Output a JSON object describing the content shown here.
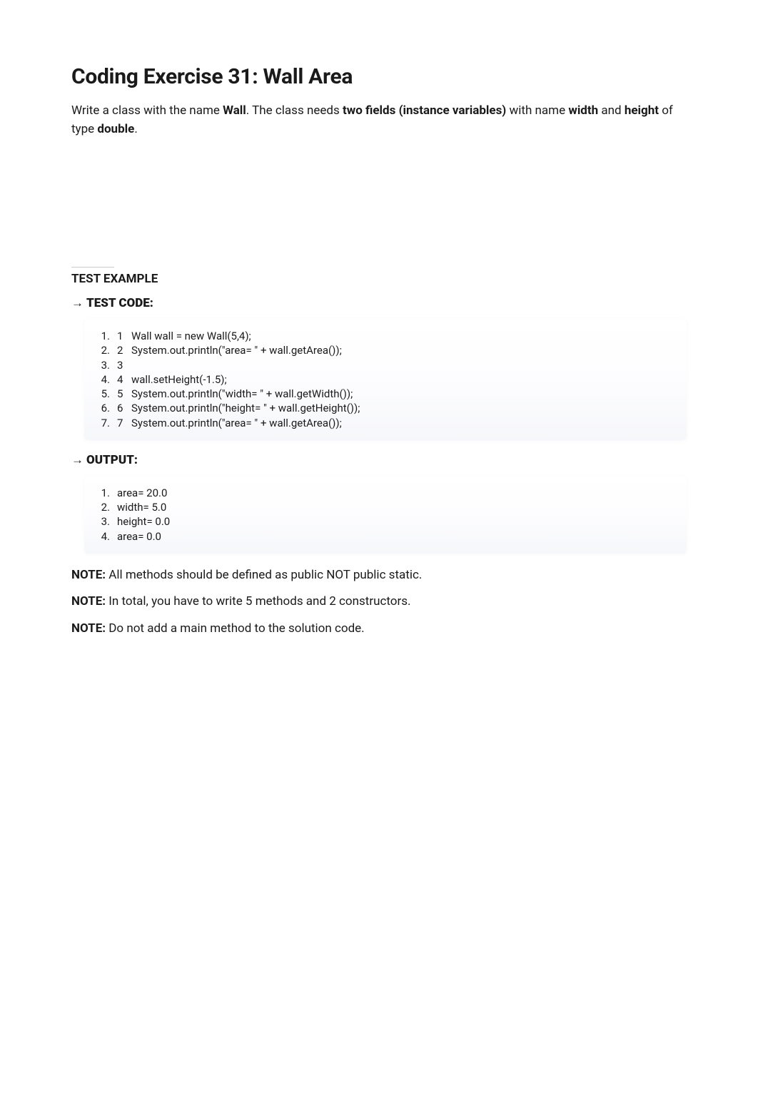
{
  "title": "Coding Exercise 31: Wall Area",
  "intro": {
    "t1": "Write a class with the name ",
    "b1": "Wall",
    "t2": ". The class needs ",
    "b2": "two fields (instance variables)",
    "t3": " with name ",
    "b3": "width",
    "t4": " and ",
    "b4": "height",
    "t5": " of type ",
    "b5": "double",
    "t6": "."
  },
  "section1": "TEST EXAMPLE",
  "subheading1": "TEST CODE:",
  "subheading2": "OUTPUT:",
  "arrow": "→",
  "code_lines": [
    {
      "outer": "1",
      "inner": "1",
      "text": "Wall wall = new Wall(5,4);"
    },
    {
      "outer": "2",
      "inner": "2",
      "text": "System.out.println(\"area= \" + wall.getArea());"
    },
    {
      "outer": "3",
      "inner": "3",
      "text": ""
    },
    {
      "outer": "4",
      "inner": "4",
      "text": "wall.setHeight(-1.5);"
    },
    {
      "outer": "5",
      "inner": "5",
      "text": "System.out.println(\"width= \" + wall.getWidth());"
    },
    {
      "outer": "6",
      "inner": "6",
      "text": "System.out.println(\"height= \" + wall.getHeight());"
    },
    {
      "outer": "7",
      "inner": "7",
      "text": "System.out.println(\"area= \" + wall.getArea());"
    }
  ],
  "output_lines": [
    {
      "num": "1",
      "text": "area= 20.0"
    },
    {
      "num": "2",
      "text": "width= 5.0"
    },
    {
      "num": "3",
      "text": "height= 0.0"
    },
    {
      "num": "4",
      "text": "area= 0.0"
    }
  ],
  "notes": [
    {
      "label": " NOTE:",
      "text": " All methods should be defined as public NOT public static."
    },
    {
      "label": "NOTE:",
      "text": " In total, you have to write 5 methods and 2 constructors."
    },
    {
      "label": "NOTE:",
      "text": " Do not add a main method to the solution code."
    }
  ]
}
